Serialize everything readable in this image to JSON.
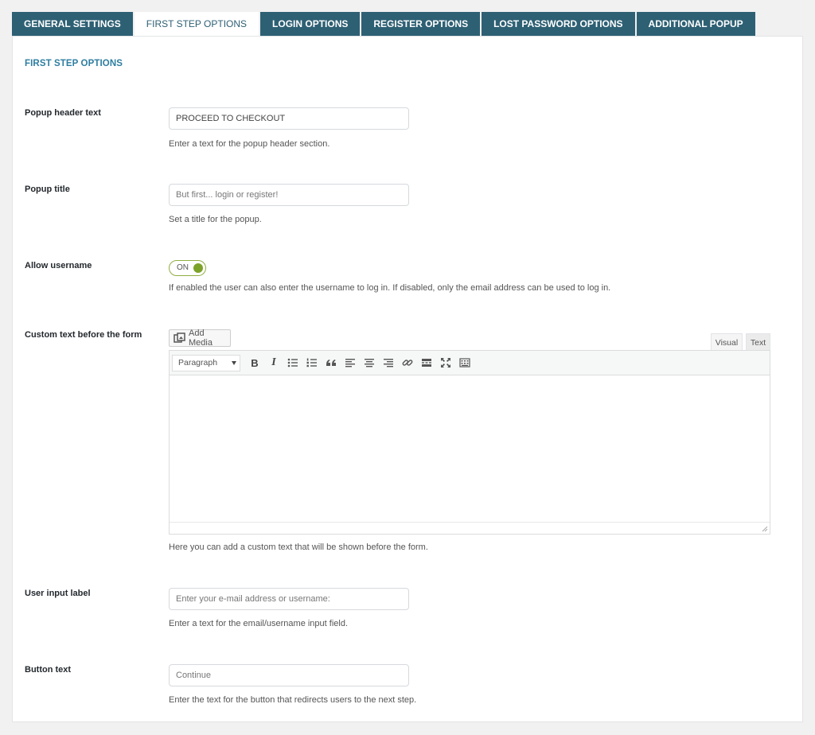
{
  "tabs": [
    {
      "label": "GENERAL SETTINGS",
      "active": false
    },
    {
      "label": "FIRST STEP OPTIONS",
      "active": true
    },
    {
      "label": "LOGIN OPTIONS",
      "active": false
    },
    {
      "label": "REGISTER OPTIONS",
      "active": false
    },
    {
      "label": "LOST PASSWORD OPTIONS",
      "active": false
    },
    {
      "label": "ADDITIONAL POPUP",
      "active": false
    }
  ],
  "section_title": "FIRST STEP OPTIONS",
  "popup_header": {
    "label": "Popup header text",
    "value": "PROCEED TO CHECKOUT",
    "description": "Enter a text for the popup header section."
  },
  "popup_title": {
    "label": "Popup title",
    "placeholder": "But first... login or register!",
    "description": "Set a title for the popup."
  },
  "allow_username": {
    "label": "Allow username",
    "toggle_state": "ON",
    "description": "If enabled the user can also enter the username to log in. If disabled, only the email address can be used to log in."
  },
  "custom_text": {
    "label": "Custom text before the form",
    "add_media_label": "Add Media",
    "mode_visual": "Visual",
    "mode_text": "Text",
    "format_select": "Paragraph",
    "toolbar_bold": "B",
    "toolbar_italic": "I",
    "toolbar_icons": [
      "bold-icon",
      "italic-icon",
      "bullet-list-icon",
      "numbered-list-icon",
      "blockquote-icon",
      "align-left-icon",
      "align-center-icon",
      "align-right-icon",
      "link-icon",
      "read-more-icon",
      "fullscreen-icon",
      "toolbar-toggle-icon"
    ],
    "description": "Here you can add a custom text that will be shown before the form."
  },
  "user_input_label": {
    "label": "User input label",
    "placeholder": "Enter your e-mail address or username:",
    "description": "Enter a text for the email/username input field."
  },
  "button_text": {
    "label": "Button text",
    "placeholder": "Continue",
    "description": "Enter the text for the button that redirects users to the next step."
  },
  "colors": {
    "tab_bg": "#2e6074",
    "section_title": "#2e7ea1",
    "toggle_on": "#7da22a"
  }
}
